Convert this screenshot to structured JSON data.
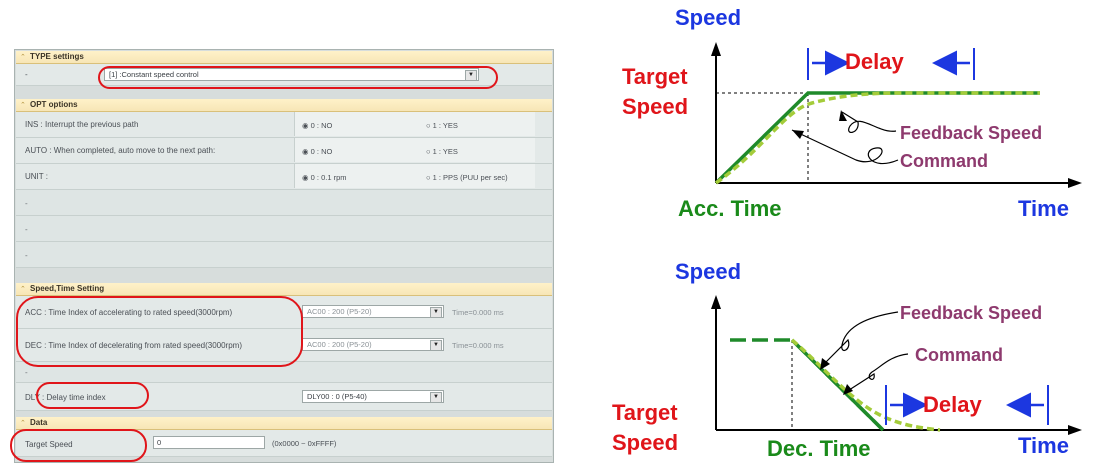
{
  "panel": {
    "type_section": {
      "title": "TYPE settings",
      "dash": "-",
      "select_value": "[1] :Constant speed control"
    },
    "opt_section": {
      "title": "OPT options",
      "rows": [
        {
          "label": "INS : Interrupt the previous path",
          "opt0": "0 : NO",
          "opt1": "1 : YES"
        },
        {
          "label": "AUTO : When completed, auto move to the next path:",
          "opt0": "0 : NO",
          "opt1": "1 : YES"
        },
        {
          "label": "UNIT :",
          "opt0": "0 : 0.1 rpm",
          "opt1": "1 : PPS (PUU per sec)"
        }
      ],
      "blank_dash": "-"
    },
    "speed_section": {
      "title": "Speed,Time Setting",
      "acc_label": "ACC : Time Index of accelerating to rated speed(3000rpm)",
      "acc_value": "AC00 : 200 (P5-20)",
      "acc_time": "Time=0.000 ms",
      "dec_label": "DEC : Time Index of decelerating from rated speed(3000rpm)",
      "dec_value": "AC00 : 200 (P5-20)",
      "dec_time": "Time=0.000 ms",
      "dash": "-",
      "dly_label": "DLY : Delay time index",
      "dly_value": "DLY00 : 0 (P5-40)"
    },
    "data_section": {
      "title": "Data",
      "target_label": "Target Speed",
      "target_value": "0",
      "range": "(0x0000 ~ 0xFFFF)"
    }
  },
  "diagram_top": {
    "y_label": "Speed",
    "target_label_1": "Target",
    "target_label_2": "Speed",
    "delay_label": "Delay",
    "feedback_label": "Feedback Speed",
    "command_label": "Command",
    "acc_label": "Acc. Time",
    "x_label": "Time"
  },
  "diagram_bottom": {
    "y_label": "Speed",
    "feedback_label": "Feedback Speed",
    "command_label": "Command",
    "delay_label": "Delay",
    "target_label_1": "Target",
    "target_label_2": "Speed",
    "dec_label": "Dec. Time",
    "x_label": "Time"
  },
  "colors": {
    "highlight": "#e0151a",
    "axis_label": "#1c37e0",
    "target_label": "#e0151a",
    "annotation": "#8e3a6e",
    "command_line": "#1f8a2a",
    "feedback_line": "#a4cc3a",
    "time_label": "#1a8a1a",
    "delay_label": "#e0151a",
    "delay_marker": "#1c37e0"
  }
}
